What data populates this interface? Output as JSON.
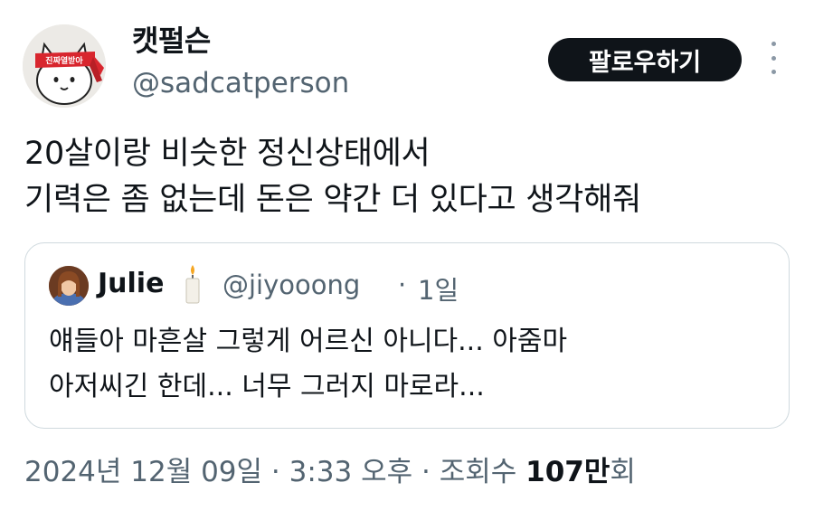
{
  "author": {
    "name": "캣펄슨",
    "handle": "@sadcatperson",
    "avatar_icon": "cat-with-headband-avatar-icon",
    "headband_text": "진짜열받아"
  },
  "follow_button": {
    "label": "팔로우하기"
  },
  "more_icon": "more-vertical-icon",
  "tweet": {
    "lines": [
      "20살이랑 비슷한 정신상태에서",
      "기력은 좀 없는데 돈은 약간 더 있다고 생각해줘"
    ]
  },
  "quoted_tweet": {
    "name": "Julie",
    "emoji_icon": "candle-icon",
    "handle": "@jiyooong",
    "separator": "·",
    "time": "1일",
    "lines": [
      "얘들아 마흔살 그렇게 어르신 아니다... 아줌마",
      "아저씨긴 한데... 너무 그러지 마로라..."
    ]
  },
  "meta": {
    "date": "2024년 12월 09일",
    "sep1": " · ",
    "time": "3:33 오후",
    "sep2": " · ",
    "views_label": "조회수 ",
    "views_count": "107만",
    "views_suffix": "회"
  },
  "colors": {
    "text_primary": "#0f1419",
    "text_secondary": "#536471",
    "border": "#cfd9de",
    "follow_bg": "#0f1419",
    "headband_red": "#d8262e"
  }
}
